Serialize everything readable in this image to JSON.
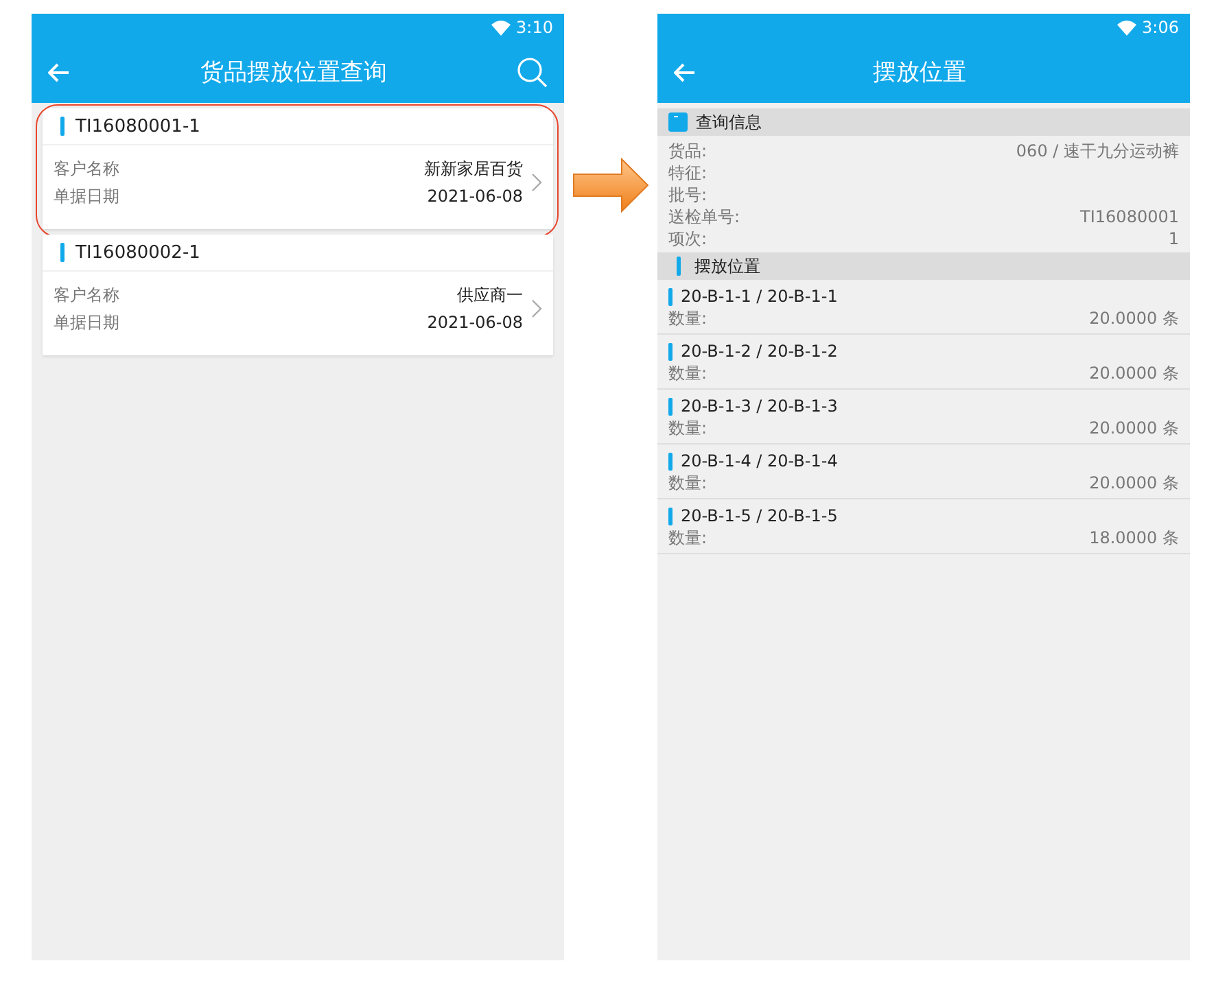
{
  "left_screen": {
    "status_bar": {
      "time": "3:10"
    },
    "app_bar": {
      "title": "货品摆放位置查询"
    },
    "cards": [
      {
        "code": "TI16080001-1",
        "highlighted": true,
        "fields": [
          {
            "label": "客户名称",
            "value": "新新家居百货"
          },
          {
            "label": "单据日期",
            "value": "2021-06-08"
          }
        ]
      },
      {
        "code": "TI16080002-1",
        "highlighted": false,
        "fields": [
          {
            "label": "客户名称",
            "value": "供应商一"
          },
          {
            "label": "单据日期",
            "value": "2021-06-08"
          }
        ]
      }
    ]
  },
  "right_screen": {
    "status_bar": {
      "time": "3:06"
    },
    "app_bar": {
      "title": "摆放位置"
    },
    "info_section": {
      "title": "查询信息",
      "rows": [
        {
          "label": "货品:",
          "value": "060 / 速干九分运动裤"
        },
        {
          "label": "特征:"
        },
        {
          "label": "批号:"
        },
        {
          "label": "送检单号:",
          "value": "TI16080001"
        },
        {
          "label": "项次:",
          "value": "1"
        }
      ]
    },
    "location_section": {
      "title": "摆放位置",
      "items": [
        {
          "location": "20-B-1-1 / 20-B-1-1",
          "label": "数量:",
          "quantity": "20.0000 条"
        },
        {
          "location": "20-B-1-2 / 20-B-1-2",
          "label": "数量:",
          "quantity": "20.0000 条"
        },
        {
          "location": "20-B-1-3 / 20-B-1-3",
          "label": "数量:",
          "quantity": "20.0000 条"
        },
        {
          "location": "20-B-1-4 / 20-B-1-4",
          "label": "数量:",
          "quantity": "20.0000 条"
        },
        {
          "location": "20-B-1-5 / 20-B-1-5",
          "label": "数量:",
          "quantity": "18.0000 条"
        }
      ]
    }
  }
}
